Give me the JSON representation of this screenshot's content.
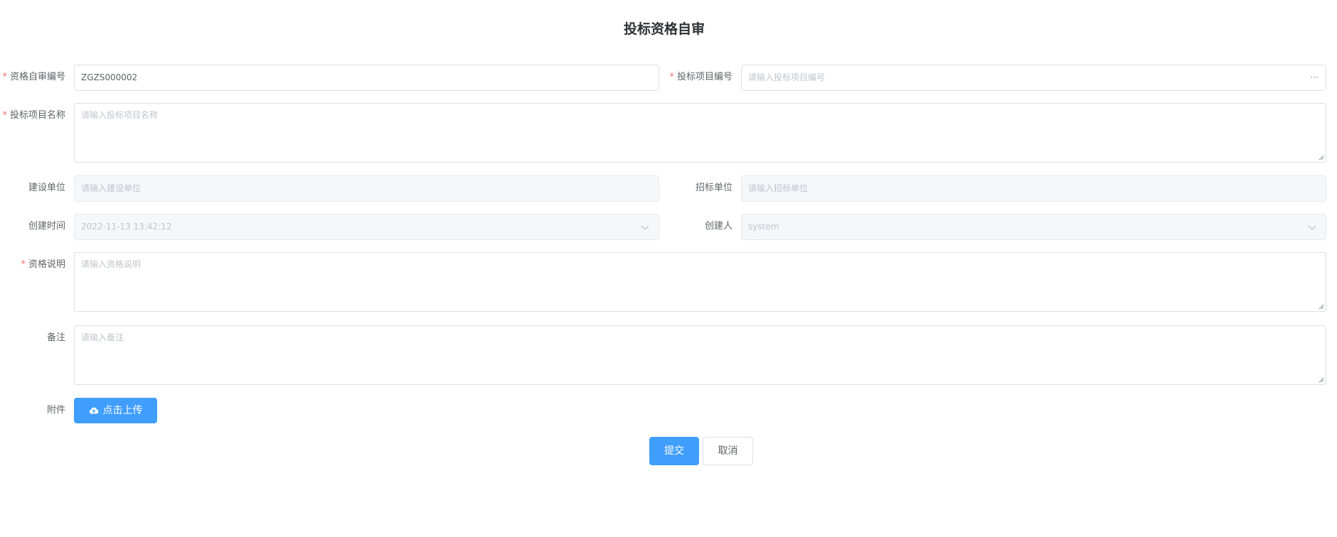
{
  "form": {
    "title": "投标资格自审",
    "fields": {
      "review_no": {
        "label": "资格自审编号",
        "value": "ZGZS000002",
        "required": true
      },
      "project_no": {
        "label": "投标项目编号",
        "placeholder": "请输入投标项目编号",
        "required": true,
        "suffix": "···"
      },
      "project_name": {
        "label": "投标项目名称",
        "placeholder": "请输入投标项目名称",
        "required": true
      },
      "construction_unit": {
        "label": "建设单位",
        "placeholder": "请输入建设单位"
      },
      "tender_unit": {
        "label": "招标单位",
        "placeholder": "请输入招标单位"
      },
      "created_time": {
        "label": "创建时间",
        "value": "2022-11-13 13:42:12"
      },
      "creator": {
        "label": "创建人",
        "value": "system"
      },
      "qualification_desc": {
        "label": "资格说明",
        "placeholder": "请输入资格说明",
        "required": true
      },
      "remark": {
        "label": "备注",
        "placeholder": "请输入备注"
      },
      "attachment": {
        "label": "附件",
        "upload_label": "点击上传"
      }
    },
    "required_mark": "*",
    "actions": {
      "submit": "提交",
      "cancel": "取消"
    }
  },
  "icons": {
    "upload": "cloud-upload-icon",
    "chevron": "chevron-down-icon",
    "more": "more-icon"
  },
  "colors": {
    "primary": "#409eff",
    "required": "#f56c6c",
    "border": "#dcdfe6",
    "disabled_bg": "#f5f7fa"
  }
}
